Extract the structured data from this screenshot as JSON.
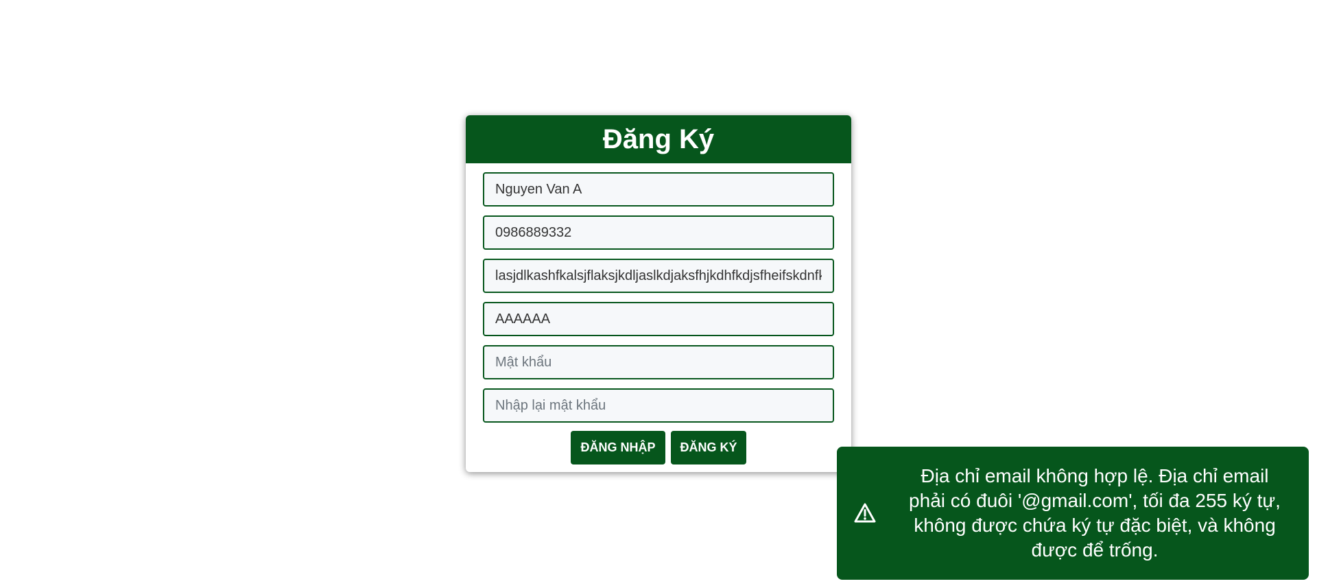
{
  "header": {
    "title": "Đăng Ký"
  },
  "form": {
    "fields": [
      {
        "value": "Nguyen Van A",
        "placeholder": ""
      },
      {
        "value": "0986889332",
        "placeholder": ""
      },
      {
        "value": "lasjdlkashfkalsjflaksjkdljaslkdjaksfhjkdhfkdjsfheifskdnfk",
        "placeholder": ""
      },
      {
        "value": "AAAAAA",
        "placeholder": ""
      },
      {
        "value": "",
        "placeholder": "Mật khẩu"
      },
      {
        "value": "",
        "placeholder": "Nhập lại mật khẩu"
      }
    ],
    "login_label": "ĐĂNG NHẬP",
    "register_label": "ĐĂNG KÝ"
  },
  "toast": {
    "icon": "warning-icon",
    "message": "Địa chỉ email không hợp lệ. Địa chỉ email phải có đuôi '@gmail.com', tối đa 255 ký tự, không được chứa ký tự đặc biệt, và không được để trống."
  },
  "colors": {
    "primary": "#06561c",
    "field_background": "#f6f8fa"
  }
}
